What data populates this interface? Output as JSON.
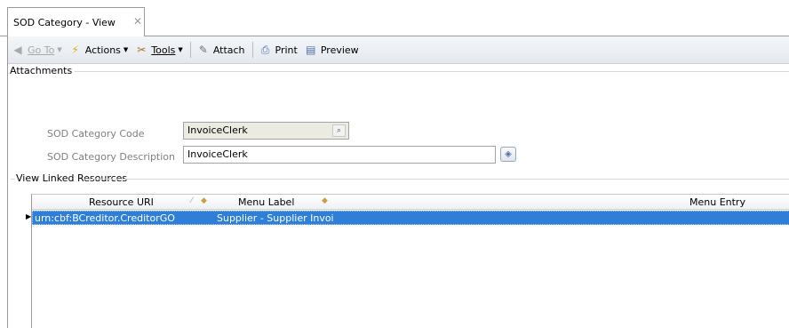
{
  "tab": {
    "title": "SOD Category - View",
    "close": "✕"
  },
  "toolbar": {
    "goto": "Go To",
    "actions": "Actions",
    "tools": "Tools",
    "attach": "Attach",
    "print": "Print",
    "preview": "Preview"
  },
  "sections": {
    "attachments": "Attachments",
    "linked": "View Linked Resources"
  },
  "form": {
    "code_label": "SOD Category Code",
    "code_value": "InvoiceClerk",
    "desc_label": "SOD Category Description",
    "desc_value": "InvoiceClerk"
  },
  "grid": {
    "columns": [
      "Resource URI",
      "Menu Label",
      "Menu Entry"
    ],
    "rows": [
      {
        "uri": "urn:cbf:BCreditor.CreditorGO",
        "label": "Supplier - Supplier Invoi",
        "entry": ""
      }
    ]
  },
  "colors": {
    "selection": "#2f7fd8",
    "toolbar": "#e4e8ee"
  }
}
